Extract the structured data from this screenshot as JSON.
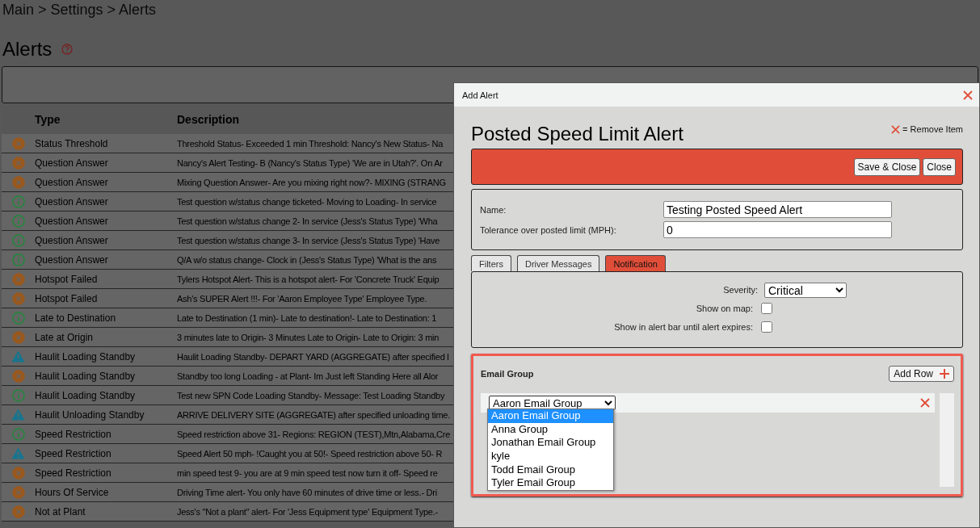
{
  "breadcrumb": "Main > Settings > Alerts",
  "page_title": "Alerts",
  "table": {
    "columns": [
      "Type",
      "Description"
    ],
    "rows": [
      {
        "kind": "error",
        "type": "Status Threshold",
        "description": "Threshold Status- Exceeded 1 min Threshold: Nancy's New Status- Na"
      },
      {
        "kind": "error",
        "type": "Question Answer",
        "description": "Nancy's Alert Testing- B (Nancy's Status Type) 'We are in Utah?'. On Ar"
      },
      {
        "kind": "error",
        "type": "Question Answer",
        "description": "Mixing Question Answer- Are you mixing right now?- MIXING (STRANG"
      },
      {
        "kind": "info",
        "type": "Question Answer",
        "description": "Test question w/status change ticketed- Moving to Loading- In service"
      },
      {
        "kind": "info",
        "type": "Question Answer",
        "description": "Test question w/status change 2- In service (Jess's Status Type) 'Wha"
      },
      {
        "kind": "info",
        "type": "Question Answer",
        "description": "Test question w/status change 3- In service (Jess's Status Type) 'Have"
      },
      {
        "kind": "info",
        "type": "Question Answer",
        "description": "Q/A w/o status change- Clock in (Jess's Status Type) 'What is the ans"
      },
      {
        "kind": "error",
        "type": "Hotspot Failed",
        "description": "Tylers Hotspot Alert- This is a hotspot alert- For 'Concrete Truck' Equip"
      },
      {
        "kind": "error",
        "type": "Hotspot Failed",
        "description": "Ash's SUPER Alert !!!- For 'Aaron Employee Type' Employee Type."
      },
      {
        "kind": "info",
        "type": "Late to Destination",
        "description": "Late to Destination (1 min)- Late to destination!- Late to Destination: 1"
      },
      {
        "kind": "error",
        "type": "Late at Origin",
        "description": "3 minutes late to Origin- 3 Minutes Late to Origin- Late to Origin: 3 min"
      },
      {
        "kind": "warning",
        "type": "Haulit Loading Standby",
        "description": "Haulit Loading Standby- DEPART YARD (AGGREGATE) after specified l"
      },
      {
        "kind": "error",
        "type": "Haulit Loading Standby",
        "description": "Standby too long Loading - at Plant- Im Just left Standing Here all Alor"
      },
      {
        "kind": "info",
        "type": "Haulit Loading Standby",
        "description": "Test new SPN Code Loading Standby- Message: Test Loading Standby"
      },
      {
        "kind": "warning",
        "type": "Haulit Unloading Standby",
        "description": "ARRIVE DELIVERY SITE (AGGREGATE) after specified unloading time."
      },
      {
        "kind": "info",
        "type": "Speed Restriction",
        "description": "Speed restriction above 31- Regions: REGION (TEST),Mtn,Alabama,Cre"
      },
      {
        "kind": "warning",
        "type": "Speed Restriction",
        "description": "Speed Alert 50 mph- !Caught you at 50!- Speed restriction above 50- R"
      },
      {
        "kind": "error",
        "type": "Speed Restriction",
        "description": "min speed test 9- you are at 9 min speed test now turn it off- Speed re"
      },
      {
        "kind": "error",
        "type": "Hours Of Service",
        "description": "Driving Time alert- You only have 60 minutes of drive time or less.- Dri"
      },
      {
        "kind": "error",
        "type": "Not at Plant",
        "description": "Jess's \"Not a plant\" alert- For 'Jess Equipment type' Equipment Type.-"
      }
    ]
  },
  "dialog": {
    "title": "Add Alert",
    "heading": "Posted Speed Limit Alert",
    "legend": "= Remove Item",
    "buttons": [
      "Save & Close",
      "Close"
    ],
    "fields": [
      {
        "label": "Name:",
        "value": "Testing Posted Speed Alert"
      },
      {
        "label": "Tolerance over posted limit (MPH):",
        "value": "0"
      }
    ],
    "tabs": [
      {
        "label": "Filters",
        "selected": false
      },
      {
        "label": "Driver Messages",
        "selected": false
      },
      {
        "label": "Notification",
        "selected": true
      }
    ],
    "severity": {
      "label": "Severity:",
      "value": "Critical"
    },
    "checks": [
      {
        "label": "Show on map:",
        "checked": false
      },
      {
        "label": "Show in alert bar until alert expires:",
        "checked": false
      }
    ],
    "email_group": {
      "label": "Email Group",
      "add_button": "Add Row",
      "rows": [
        {
          "value": "Aaron Email Group"
        }
      ],
      "options": [
        {
          "label": "Aaron Email Group",
          "selected": true
        },
        {
          "label": "Anna Group",
          "selected": false
        },
        {
          "label": "Jonathan Email Group",
          "selected": false
        },
        {
          "label": "kyle",
          "selected": false
        },
        {
          "label": "Todd Email Group",
          "selected": false
        },
        {
          "label": "Tyler Email Group",
          "selected": false
        }
      ]
    }
  }
}
